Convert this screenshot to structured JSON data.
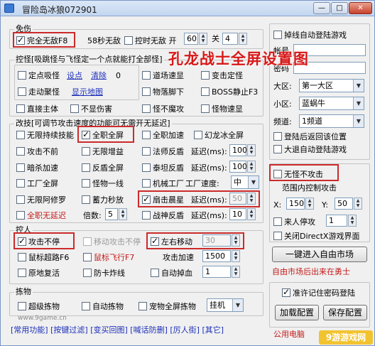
{
  "window": {
    "title": "冒险岛冰狼072901"
  },
  "overlay_text": "孔龙战士全屏设置图",
  "group_wushang": {
    "title": "免伤",
    "full_invincible": {
      "label": "完全无敌F8",
      "checked": true
    },
    "invincible_58s": "58秒无敌",
    "timed_invincible": {
      "label": "控时无敌 开",
      "on_value": "60",
      "off_label": "关",
      "off_value": "4"
    }
  },
  "group_attract": {
    "title": "控怪[吸跳怪与飞怪定一个点就能打全部怪]",
    "fixed_attract": "定点吸怪",
    "set_point": "设点",
    "clear": "清除",
    "count": "0",
    "walk_attract": "走动聚怪",
    "show_map": "显示地图",
    "direct_host": "直接主体",
    "hide_damage": "不显伤害",
    "right_col": [
      "道场速显",
      "变击定怪",
      "物落脚下",
      "BOSS静止F3",
      "怪不魔攻",
      "怪物速显"
    ]
  },
  "group_attack": {
    "title": "改技[可调节攻击速度的功能可无需开无延迟]",
    "rows": [
      [
        "无限持续技能",
        "全职全屏",
        "全职加速",
        "幻龙冰全屏"
      ],
      [
        "攻击不前",
        "无限增益",
        "法师反盾",
        "延迟(ms):"
      ],
      [
        "暗杀加速",
        "反盾全屏",
        "泰坦反盾",
        "延迟(ms):"
      ],
      [
        "工厂全屏",
        "怪物一线",
        "机械工厂",
        "工厂速度:"
      ],
      [
        "无限阿修罗",
        "蓄力秒放",
        "扇击晨星",
        "延迟(ms):"
      ],
      [
        "全职无延迟",
        "倍数:",
        "战神反盾",
        "延迟(ms):"
      ]
    ],
    "delay_values": [
      "100",
      "100",
      "50",
      "10"
    ],
    "factory_speed": "中",
    "multiplier": "5"
  },
  "group_control": {
    "title": "控人",
    "attack_nonstop": "攻击不停",
    "move_attack_nonstop": "移动攻击不停",
    "left_right_move": "左右移动",
    "left_right_value": "30",
    "mouse_speed": "鼠标超路F6",
    "mouse_fly": "鼠标飞行F7",
    "attack_speed_label": "攻击加速",
    "attack_speed_value": "1500",
    "revive_in_place": "原地复活",
    "anti_lag": "防卡炸线",
    "auto_drop": "自动掉血",
    "auto_drop_value": "1"
  },
  "group_pickup": {
    "title": "拣物",
    "super_pickup": "超级拣物",
    "auto_pickup": "自动拣物",
    "pet_pickup": "宠物全屏拣物",
    "pet_mode": "挂机"
  },
  "right_panel": {
    "reconnect_login": "掉线自动登陆游戏",
    "account_label": "帐号",
    "password_label": "密码",
    "region_label": "大区:",
    "region_value": "第一大区",
    "subregion_label": "小区:",
    "subregion_value": "蓝蜗牛",
    "channel_label": "频道:",
    "channel_value": "1频道",
    "return_position": "登陆后返回该位置",
    "auto_login_after_exit": "大退自动登陆游戏",
    "no_monster_noattack": "无怪不攻击",
    "range_control": "范围内控制攻击",
    "x_label": "X:",
    "x_value": "150",
    "y_label": "Y:",
    "y_value": "50",
    "stop_on_people": "来人停攻",
    "people_value": "1",
    "close_directx": "关闭DirectX游戏界面",
    "enter_market": "一键进入自由市场",
    "market_note": "自由市场后出来在勇士",
    "remember_password": "准许记住密码登陆",
    "load_config": "加载配置",
    "save_config": "保存配置",
    "public_pc": "公用电脑"
  },
  "statusbar": [
    "[常用功能]",
    "[按键过滤]",
    "[变买回图]",
    "[喊话防删]",
    "[厉人街]",
    "[其它]"
  ],
  "site_mark": "www.9game.cn",
  "watermark": "9游游戏网"
}
